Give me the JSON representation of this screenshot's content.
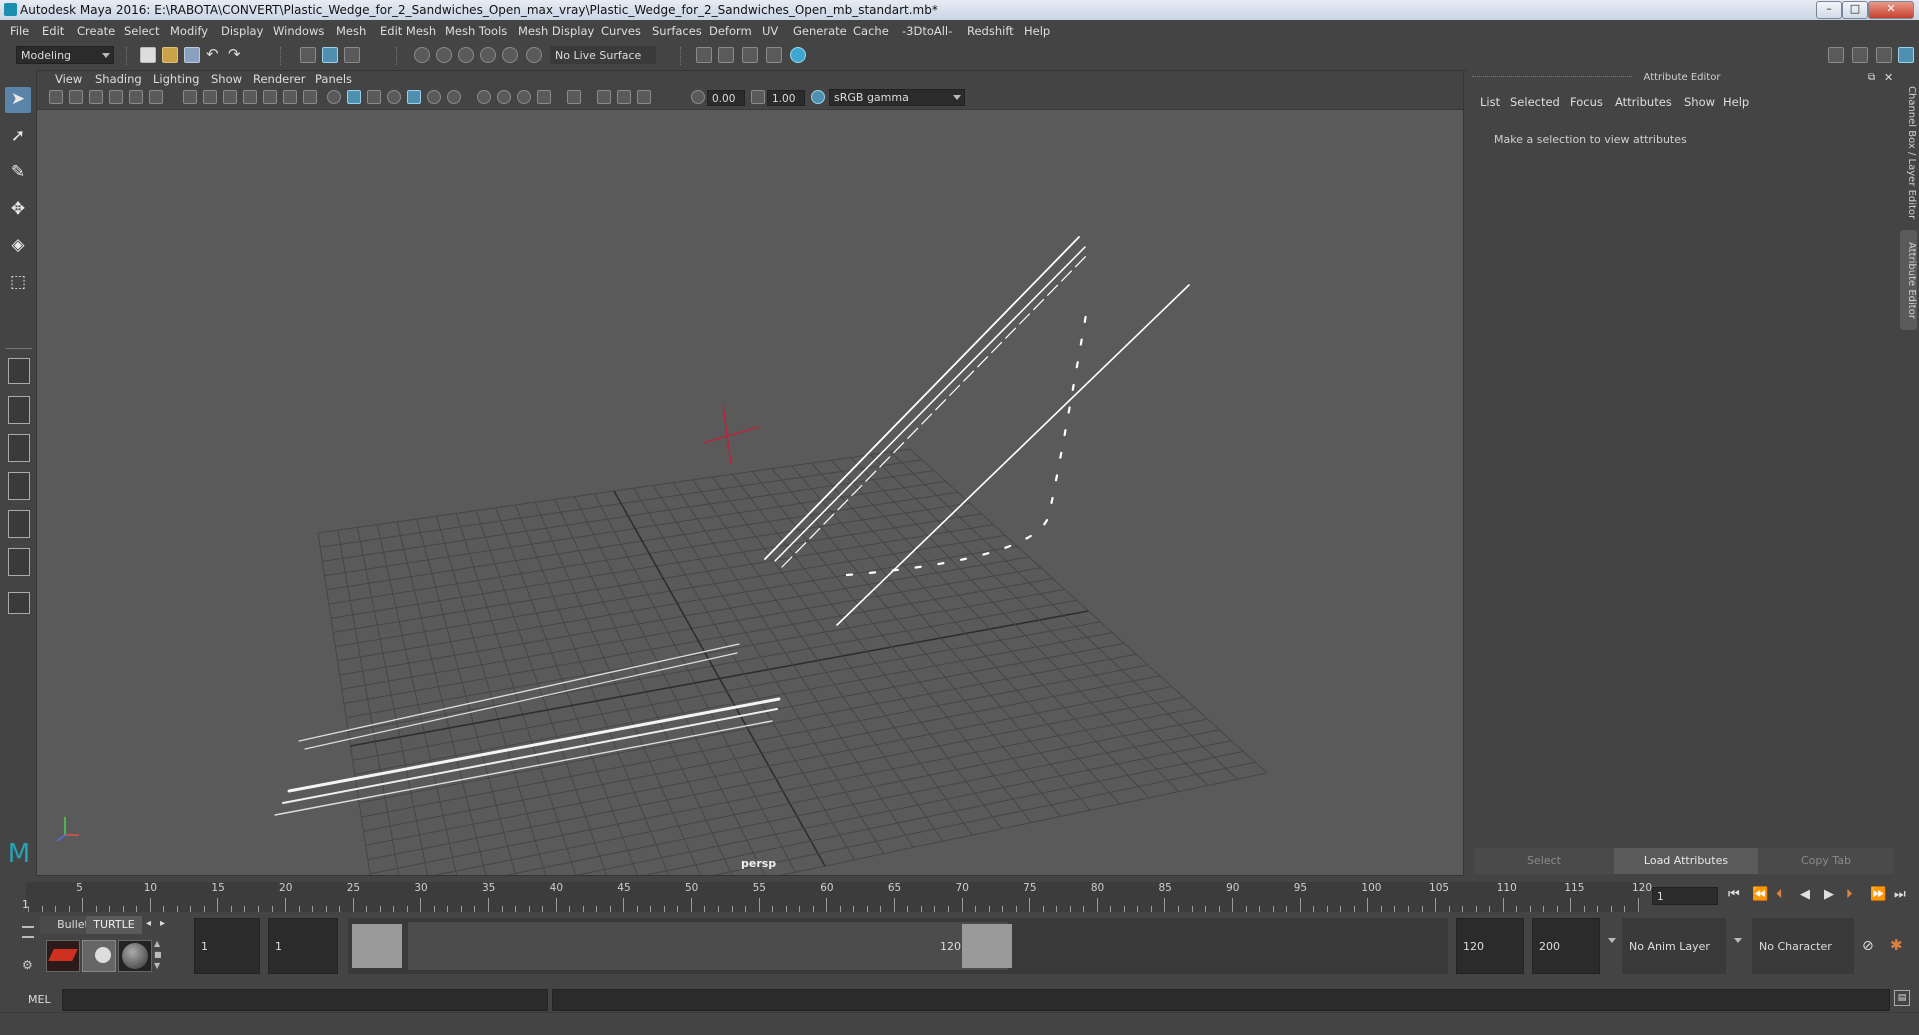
{
  "window": {
    "title": "Autodesk Maya 2016: E:\\RABOTA\\CONVERT\\Plastic_Wedge_for_2_Sandwiches_Open_max_vray\\Plastic_Wedge_for_2_Sandwiches_Open_mb_standart.mb*",
    "minimize": "–",
    "maximize": "□",
    "close": "✕"
  },
  "menu": [
    "File",
    "Edit",
    "Create",
    "Select",
    "Modify",
    "Display",
    "Windows",
    "Mesh",
    "Edit Mesh",
    "Mesh Tools",
    "Mesh Display",
    "Curves",
    "Surfaces",
    "Deform",
    "UV",
    "Generate",
    "Cache",
    "-3DtoAll-",
    "Redshift",
    "Help"
  ],
  "status": {
    "mode": "Modeling",
    "live_surface": "No Live Surface"
  },
  "viewport": {
    "menu": [
      "View",
      "Shading",
      "Lighting",
      "Show",
      "Renderer",
      "Panels"
    ],
    "exposure": "0.00",
    "gamma": "1.00",
    "color_space": "sRGB gamma",
    "camera_label": "persp"
  },
  "attribute_editor": {
    "title": "Attribute Editor",
    "tabs": [
      "List",
      "Selected",
      "Focus",
      "Attributes",
      "Show",
      "Help"
    ],
    "message": "Make a selection to view attributes",
    "buttons": {
      "select": "Select",
      "load": "Load Attributes",
      "copy": "Copy Tab"
    }
  },
  "side_tabs": {
    "channel_box": "Channel Box / Layer Editor",
    "attribute_editor": "Attribute Editor"
  },
  "timeline": {
    "ticks": [
      5,
      10,
      15,
      20,
      25,
      30,
      35,
      40,
      45,
      50,
      55,
      60,
      65,
      70,
      75,
      80,
      85,
      90,
      95,
      100,
      105,
      110,
      115,
      120
    ],
    "current_marker": "1",
    "current_frame": "1"
  },
  "range": {
    "shelf_tab_bullet": "Bullet",
    "shelf_tab_turtle": "TURTLE",
    "start_frame": "1",
    "playback_start": "1",
    "slider_start": "1",
    "slider_end": "120",
    "playback_end": "120",
    "end_frame": "200",
    "anim_layer": "No Anim Layer",
    "character_set": "No Character Set"
  },
  "command": {
    "language": "MEL"
  },
  "colors": {
    "accent": "#5a84a8",
    "viewport_bg": "#5a5a5a",
    "panel_bg": "#444444",
    "pivot": "#c0203c"
  }
}
